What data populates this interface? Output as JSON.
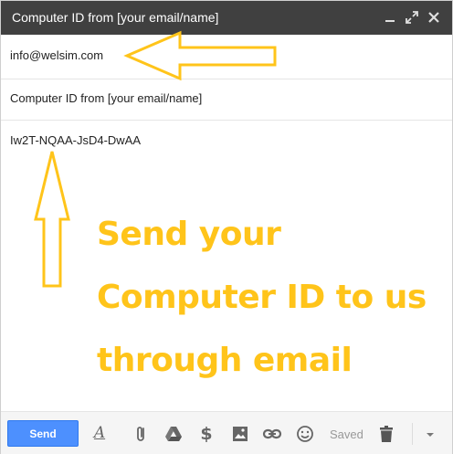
{
  "window": {
    "title": "Computer ID from [your email/name]"
  },
  "compose": {
    "to_value": "info@welsim.com",
    "subject_value": "Computer ID from [your email/name]",
    "body_text": "Iw2T-NQAA-JsD4-DwAA"
  },
  "annotation": {
    "lines": [
      "Send your",
      "Computer ID to us",
      "through email"
    ],
    "color": "#ffc41a"
  },
  "toolbar": {
    "send_label": "Send",
    "saved_label": "Saved",
    "icons": [
      "formatting-icon",
      "attach-icon",
      "drive-icon",
      "money-icon",
      "photo-icon",
      "link-icon",
      "emoji-icon",
      "trash-icon",
      "more-options-icon"
    ]
  },
  "colors": {
    "titlebar": "#404040",
    "send_button": "#4d90fe",
    "annotation": "#ffc41a"
  }
}
